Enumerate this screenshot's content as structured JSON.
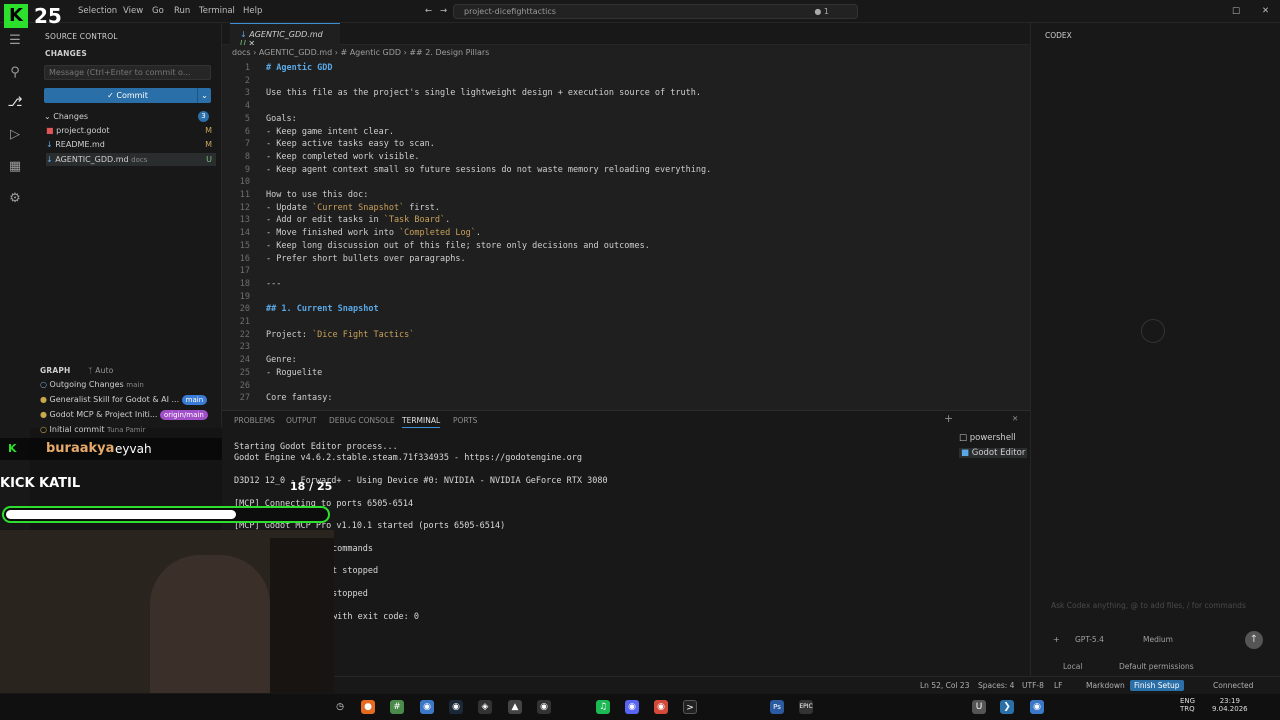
{
  "titlebar": {
    "menus": [
      "Selection",
      "View",
      "Go",
      "Run",
      "Terminal",
      "Help"
    ],
    "search": "project-dicefighttactics",
    "count": "1"
  },
  "overlay": {
    "logo_text": "25",
    "chat_user": "buraakya",
    "chat_msg": "eyvah",
    "kick_label": "KICK KATIL",
    "progress_text": "18 / 25",
    "progress": 0.72
  },
  "sidebar": {
    "title": "SOURCE CONTROL",
    "changes_header": "CHANGES",
    "commit_placeholder": "Message (Ctrl+Enter to commit o...",
    "commit_label": "Commit",
    "group": "Changes",
    "badge": "3",
    "files": [
      {
        "name": "project.godot",
        "status": "M"
      },
      {
        "name": "README.md",
        "status": "M"
      },
      {
        "name": "AGENTIC_GDD.md",
        "dir": "docs",
        "status": "U"
      }
    ],
    "graph_title": "GRAPH",
    "graph_auto": "Auto",
    "graph": [
      {
        "msg": "Outgoing Changes",
        "ref": "main",
        "tag": ""
      },
      {
        "msg": "Generalist Skill for Godot & AI ...",
        "ref": "",
        "tag": "main"
      },
      {
        "msg": "Godot MCP & Project Initi...",
        "ref": "",
        "tag": "origin/main"
      },
      {
        "msg": "Initial commit",
        "ref": "Tuna Pamir",
        "tag": ""
      }
    ]
  },
  "editor": {
    "tab": "AGENTIC_GDD.md",
    "tab_status": "U",
    "breadcrumb": "docs  ›  AGENTIC_GDD.md  ›  # Agentic GDD  ›  ## 2. Design Pillars",
    "lines": [
      "# Agentic GDD",
      "",
      "Use this file as the project's single lightweight design + execution source of truth.",
      "",
      "Goals:",
      "- Keep game intent clear.",
      "- Keep active tasks easy to scan.",
      "- Keep completed work visible.",
      "- Keep agent context small so future sessions do not waste memory reloading everything.",
      "",
      "How to use this doc:",
      "- Update `Current Snapshot` first.",
      "- Add or edit tasks in `Task Board`.",
      "- Move finished work into `Completed Log`.",
      "- Keep long discussion out of this file; store only decisions and outcomes.",
      "- Prefer short bullets over paragraphs.",
      "",
      "---",
      "",
      "## 1. Current Snapshot",
      "",
      "Project: `Dice Fight Tactics`",
      "",
      "Genre:",
      "- Roguelite",
      "",
      "Core fantasy:"
    ]
  },
  "panel": {
    "tabs": [
      "PROBLEMS",
      "OUTPUT",
      "DEBUG CONSOLE",
      "TERMINAL",
      "PORTS"
    ],
    "terminal": [
      "Starting Godot Editor process...",
      "Godot Engine v4.6.2.stable.steam.71f334935 - https://godotengine.org",
      "",
      "D3D12 12_0 - Forward+ - Using Device #0: NVIDIA - NVIDIA GeForce RTX 3080",
      "",
      "[MCP] Connecting to ports 6505-6514",
      "",
      "[MCP] Godot MCP Pro v1.10.1 started (ports 6505-6514)",
      "",
      "commands",
      "",
      "t stopped",
      "",
      "stopped",
      "",
      "with exit code: 0"
    ],
    "terminals": [
      "powershell",
      "Godot Editor"
    ]
  },
  "codex": {
    "title": "CODEX",
    "placeholder": "Ask Codex anything, @ to add files, / for commands",
    "model": "GPT-5.4",
    "effort": "Medium",
    "mode": "Local",
    "perm": "Default permissions"
  },
  "status": {
    "pos": "Ln 52, Col 23",
    "spaces": "Spaces: 4",
    "enc": "UTF-8",
    "eol": "LF",
    "lang": "Markdown",
    "finish": "Finish Setup",
    "conn": "Connected"
  },
  "taskbar": {
    "lang": "ENG",
    "lang2": "TRQ",
    "time": "23:19",
    "date": "9.04.2026"
  },
  "colors": {
    "accent": "#2a6fa8",
    "kick_green": "#2ee02e"
  }
}
